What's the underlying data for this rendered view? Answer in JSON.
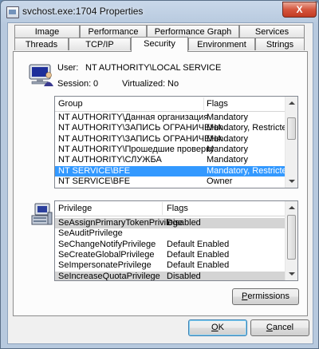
{
  "window": {
    "title": "svchost.exe:1704 Properties",
    "close_glyph": "X"
  },
  "tabs_row1": [
    "Image",
    "Performance",
    "Performance Graph",
    "Services"
  ],
  "tabs_row2": [
    "Threads",
    "TCP/IP",
    "Security",
    "Environment",
    "Strings"
  ],
  "active_tab": "Security",
  "user": {
    "label": "User:",
    "value": "NT AUTHORITY\\LOCAL SERVICE"
  },
  "session": {
    "label": "Session:",
    "value": "0"
  },
  "virtualized": {
    "label": "Virtualized:",
    "value": "No"
  },
  "groups": {
    "col_group": "Group",
    "col_flags": "Flags",
    "rows": [
      {
        "group": "NT AUTHORITY\\Данная организация",
        "flags": "Mandatory"
      },
      {
        "group": "NT AUTHORITY\\ЗАПИСЬ ОГРАНИЧЕНА",
        "flags": "Mandatory, Restricted"
      },
      {
        "group": "NT AUTHORITY\\ЗАПИСЬ ОГРАНИЧЕНА",
        "flags": "Mandatory"
      },
      {
        "group": "NT AUTHORITY\\Прошедшие проверку",
        "flags": "Mandatory"
      },
      {
        "group": "NT AUTHORITY\\СЛУЖБА",
        "flags": "Mandatory"
      },
      {
        "group": "NT SERVICE\\BFE",
        "flags": "Mandatory, Restricted"
      },
      {
        "group": "NT SERVICE\\BFE",
        "flags": "Owner"
      }
    ],
    "selected_index": 5
  },
  "privileges": {
    "col_privilege": "Privilege",
    "col_flags": "Flags",
    "rows": [
      {
        "privilege": "SeAssignPrimaryTokenPrivilege",
        "flags": "Disabled"
      },
      {
        "privilege": "SeAuditPrivilege",
        "flags": ""
      },
      {
        "privilege": "SeChangeNotifyPrivilege",
        "flags": "Default Enabled"
      },
      {
        "privilege": "SeCreateGlobalPrivilege",
        "flags": "Default Enabled"
      },
      {
        "privilege": "SeImpersonatePrivilege",
        "flags": "Default Enabled"
      },
      {
        "privilege": "SeIncreaseQuotaPrivilege",
        "flags": "Disabled"
      }
    ],
    "gray_indices": [
      0,
      5
    ]
  },
  "buttons": {
    "permissions": {
      "prefix": "",
      "underlined": "P",
      "rest": "ermissions"
    },
    "ok": {
      "prefix": "",
      "underlined": "O",
      "rest": "K"
    },
    "cancel": {
      "prefix": "",
      "underlined": "C",
      "rest": "ancel"
    }
  }
}
